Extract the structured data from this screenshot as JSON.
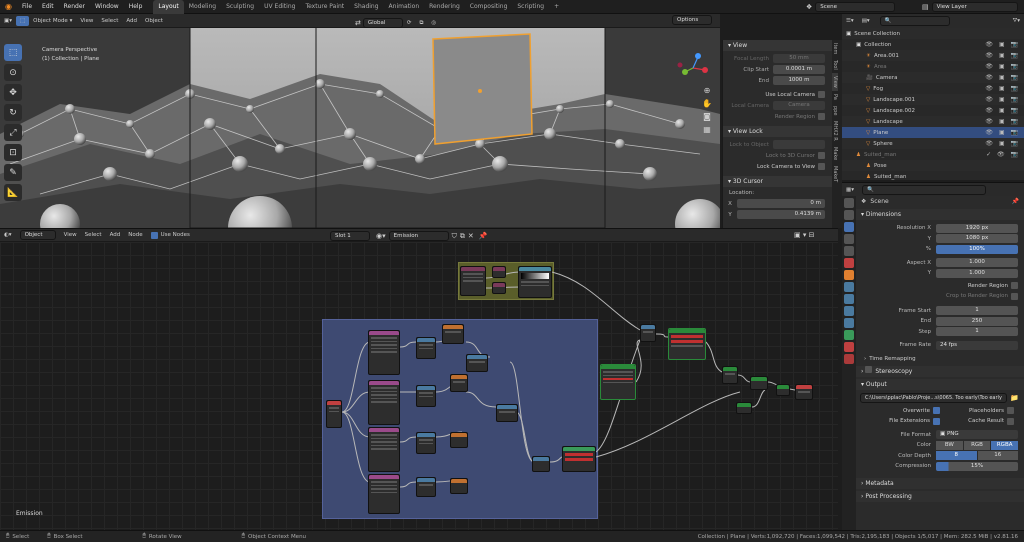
{
  "menu": [
    "File",
    "Edit",
    "Render",
    "Window",
    "Help"
  ],
  "workspaces": [
    "Layout",
    "Modeling",
    "Sculpting",
    "UV Editing",
    "Texture Paint",
    "Shading",
    "Animation",
    "Rendering",
    "Compositing",
    "Scripting",
    "+"
  ],
  "active_workspace": "Layout",
  "scene_field": "Scene",
  "view_layer_field": "View Layer",
  "viewport": {
    "mode": "Object Mode",
    "menus": [
      "View",
      "Select",
      "Add",
      "Object"
    ],
    "transform": "Global",
    "options": "Options",
    "info_line1": "Camera Perspective",
    "info_line2": "(1) Collection | Plane"
  },
  "npanel": {
    "view_title": "View",
    "focal_length_label": "Focal Length",
    "focal_length": "50 mm",
    "clip_start_label": "Clip Start",
    "clip_start": "0.0001 m",
    "end_label": "End",
    "end": "1000 m",
    "use_local_camera": "Use Local Camera",
    "local_camera_label": "Local Camera",
    "local_camera": "Camera",
    "render_region": "Render Region",
    "view_lock_title": "View Lock",
    "lock_to_object": "Lock to Object",
    "lock_to_3d_cursor": "Lock to 3D Cursor",
    "lock_camera_to_view": "Lock Camera to View",
    "cursor_title": "3D Cursor",
    "location_label": "Location:",
    "x_label": "X",
    "x": "0 m",
    "y_label": "Y",
    "y": "0.4139 m",
    "tabs": [
      "Item",
      "Tool",
      "View",
      "Pa",
      "ppe",
      "MHX2 R",
      "Make",
      "MakeT"
    ]
  },
  "node_editor": {
    "editor_type": "Object",
    "menus": [
      "View",
      "Select",
      "Add",
      "Node"
    ],
    "use_nodes": "Use Nodes",
    "slot": "Slot 1",
    "material": "Emission",
    "frame_label": "Emission"
  },
  "outliner": {
    "search_placeholder": "",
    "items": [
      {
        "name": "Scene Collection",
        "indent": 0,
        "selected": false,
        "dim": false,
        "icons": ""
      },
      {
        "name": "Collection",
        "indent": 1,
        "selected": false,
        "dim": false,
        "icons": "👁 ▣ 📷"
      },
      {
        "name": "Area.001",
        "indent": 2,
        "selected": false,
        "dim": false,
        "icons": "👁 ▣ 📷"
      },
      {
        "name": "Area",
        "indent": 2,
        "selected": false,
        "dim": true,
        "icons": "👁 ▣ 📷"
      },
      {
        "name": "Camera",
        "indent": 2,
        "selected": false,
        "dim": false,
        "icons": "👁 ▣ 📷"
      },
      {
        "name": "Fog",
        "indent": 2,
        "selected": false,
        "dim": false,
        "icons": "👁 ▣ 📷"
      },
      {
        "name": "Landscape.001",
        "indent": 2,
        "selected": false,
        "dim": false,
        "icons": "👁 ▣ 📷"
      },
      {
        "name": "Landscape.002",
        "indent": 2,
        "selected": false,
        "dim": false,
        "icons": "👁 ▣ 📷"
      },
      {
        "name": "Landscape",
        "indent": 2,
        "selected": false,
        "dim": false,
        "icons": "👁 ▣ 📷"
      },
      {
        "name": "Plane",
        "indent": 2,
        "selected": true,
        "dim": false,
        "icons": "👁 ▣ 📷"
      },
      {
        "name": "Sphere",
        "indent": 2,
        "selected": false,
        "dim": false,
        "icons": "👁 ▣ 📷"
      },
      {
        "name": "Suited_man",
        "indent": 1,
        "selected": false,
        "dim": true,
        "icons": "✓ 👁 📷"
      },
      {
        "name": "Pose",
        "indent": 2,
        "selected": false,
        "dim": false,
        "icons": ""
      },
      {
        "name": "Suited_man",
        "indent": 2,
        "selected": false,
        "dim": false,
        "icons": ""
      }
    ]
  },
  "properties": {
    "scene_name": "Scene",
    "dimensions_title": "Dimensions",
    "res_x_label": "Resolution X",
    "res_x": "1920 px",
    "res_y_label": "Y",
    "res_y": "1080 px",
    "res_pct_label": "%",
    "res_pct": "100%",
    "aspect_x_label": "Aspect X",
    "aspect_x": "1.000",
    "aspect_y_label": "Y",
    "aspect_y": "1.000",
    "render_region": "Render Region",
    "crop_to_render_region": "Crop to Render Region",
    "frame_start_label": "Frame Start",
    "frame_start": "1",
    "frame_end_label": "End",
    "frame_end": "250",
    "frame_step_label": "Step",
    "frame_step": "1",
    "frame_rate_label": "Frame Rate",
    "frame_rate": "24 fps",
    "time_remapping": "Time Remapping",
    "stereoscopy": "Stereoscopy",
    "output_title": "Output",
    "output_path": "C:\\Users\\pplac\\Pablo\\Proje...s\\0065. Too early\\Too early",
    "overwrite": "Overwrite",
    "placeholders": "Placeholders",
    "file_extensions": "File Extensions",
    "cache_result": "Cache Result",
    "file_format_label": "File Format",
    "file_format": "PNG",
    "color_label": "Color",
    "color_options": [
      "BW",
      "RGB",
      "RGBA"
    ],
    "color_selected": "RGBA",
    "color_depth_label": "Color Depth",
    "color_depth_options": [
      "8",
      "16"
    ],
    "color_depth_selected": "8",
    "compression_label": "Compression",
    "compression": "15%",
    "metadata": "Metadata",
    "post_processing": "Post Processing"
  },
  "statusbar": {
    "select": "Select",
    "box_select": "Box Select",
    "rotate_view": "Rotate View",
    "context_menu": "Object Context Menu",
    "stats": "Collection | Plane | Verts:1,092,720 | Faces:1,099,542 | Tris:2,195,183 | Objects 1/5,017 | Mem: 282.5 MiB | v2.81.16"
  },
  "colors": {
    "accent": "#4772b3",
    "selection_orange": "#f0a030",
    "frame_blue": "#3e4a72",
    "frame_olive": "#5a5e2a"
  }
}
